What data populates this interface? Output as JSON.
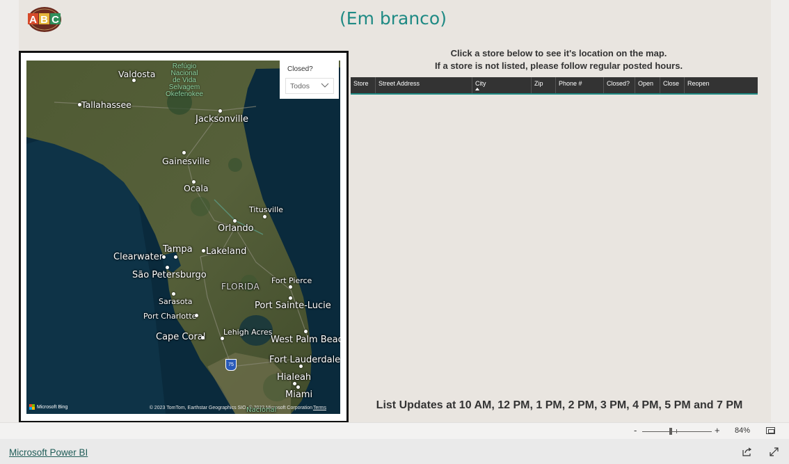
{
  "header": {
    "logo_letters": [
      "A",
      "B",
      "C"
    ],
    "title": "(Em branco)"
  },
  "map": {
    "cities": [
      {
        "key": "valdosta",
        "label": "Valdosta"
      },
      {
        "key": "tallahassee",
        "label": "Tallahassee"
      },
      {
        "key": "jacksonville",
        "label": "Jacksonville"
      },
      {
        "key": "gainesville",
        "label": "Gainesville"
      },
      {
        "key": "ocala",
        "label": "Ocala"
      },
      {
        "key": "titusville",
        "label": "Titusville"
      },
      {
        "key": "orlando",
        "label": "Orlando"
      },
      {
        "key": "tampa",
        "label": "Tampa"
      },
      {
        "key": "lakeland",
        "label": "Lakeland"
      },
      {
        "key": "clearwater",
        "label": "Clearwater"
      },
      {
        "key": "sao_petersburgo",
        "label": "São Petersburgo"
      },
      {
        "key": "florida",
        "label": "FLORIDA"
      },
      {
        "key": "fort_pierce",
        "label": "Fort Pierce"
      },
      {
        "key": "sarasota",
        "label": "Sarasota"
      },
      {
        "key": "port_sainte_lucie",
        "label": "Port Sainte-Lucie"
      },
      {
        "key": "port_charlotte",
        "label": "Port Charlotte"
      },
      {
        "key": "lehigh_acres",
        "label": "Lehigh Acres"
      },
      {
        "key": "cape_coral",
        "label": "Cape Coral"
      },
      {
        "key": "west_palm_beach",
        "label": "West Palm Beach"
      },
      {
        "key": "fort_lauderdale",
        "label": "Fort Lauderdale"
      },
      {
        "key": "hialeah",
        "label": "Hialeah"
      },
      {
        "key": "miami",
        "label": "Miami"
      }
    ],
    "park_label": "Refúgio\nNacional\nde Vida\nSelvagem\nOkefenokee",
    "highway_shield": "75",
    "bing_label": "Microsoft Bing",
    "copyright": "© 2023 TomTom, Earthstar Geographics SIO, © 2023 Microsoft Corporation",
    "terms": "Terms",
    "bottom_partial": "Nacional"
  },
  "slicer": {
    "label": "Closed?",
    "value": "Todos"
  },
  "instructions": {
    "line1": "Click a store below to see it's location on the map.",
    "line2": "If a store is not listed, please follow regular posted hours."
  },
  "table": {
    "columns": [
      "Store",
      "Street Address",
      "City",
      "Zip",
      "Phone #",
      "Closed?",
      "Open",
      "Close",
      "Reopen"
    ],
    "sorted_column": "City"
  },
  "footer_note": "List Updates at 10 AM, 12 PM, 1 PM, 2 PM, 3 PM, 4 PM, 5 PM and 7 PM",
  "zoom": {
    "minus": "-",
    "plus": "+",
    "percent": "84%"
  },
  "bottom": {
    "link": "Microsoft Power BI"
  },
  "colors": {
    "accent": "#1f8a84",
    "canvas": "#e9e5e0",
    "table_header": "#333333"
  }
}
